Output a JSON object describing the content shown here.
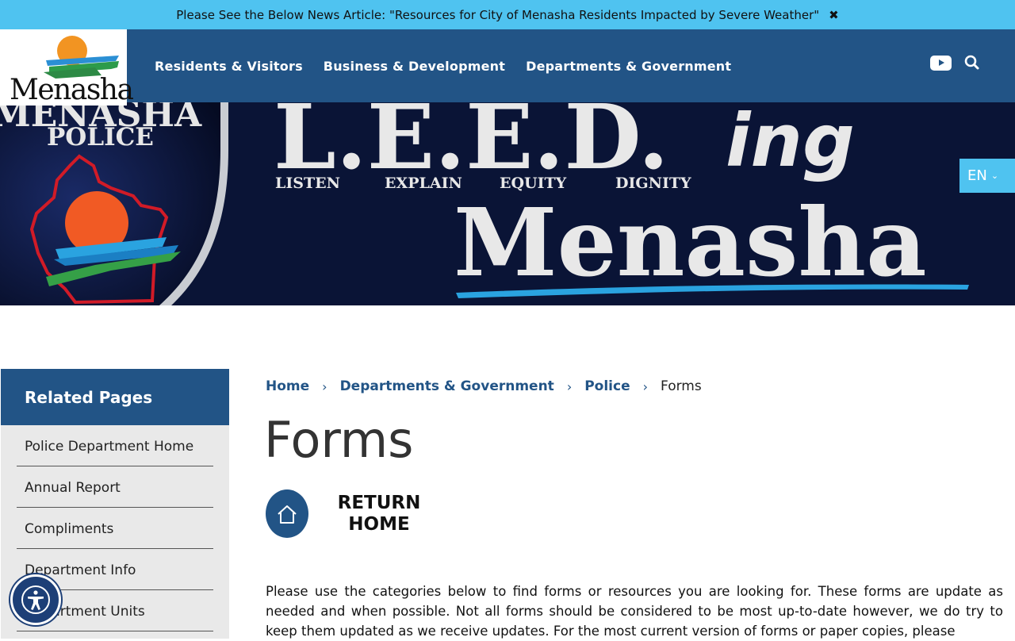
{
  "alert": {
    "text": "Please See the Below News Article: \"Resources for City of Menasha Residents Impacted by Severe Weather\"",
    "close_icon": "close-icon"
  },
  "logo": {
    "wordmark": "Menasha"
  },
  "nav": {
    "items": [
      "Residents & Visitors",
      "Business & Development",
      "Departments & Government"
    ]
  },
  "header_icons": {
    "youtube": "youtube-icon",
    "search": "search-icon"
  },
  "hero": {
    "badge_text": "MENASHA",
    "badge_sub": "POLICE",
    "headline": "L.E.E.D.",
    "headline_suffix": "ing",
    "words": [
      "LISTEN",
      "EXPLAIN",
      "EQUITY",
      "DIGNITY"
    ],
    "city": "Menasha"
  },
  "language": {
    "label": "EN"
  },
  "sidebar": {
    "heading": "Related Pages",
    "items": [
      "Police Department Home",
      "Annual Report",
      "Compliments",
      "Department Info",
      "Department Units"
    ]
  },
  "breadcrumb": {
    "home": "Home",
    "dept": "Departments & Government",
    "police": "Police",
    "current": "Forms"
  },
  "page": {
    "title": "Forms",
    "return_home": "RETURN HOME",
    "intro": "Please use the categories below to find forms or resources you are looking for.  These forms are update as needed and when possible.  Not all forms should be considered to be most up-to-date however, we do try to keep them updated as we receive updates.  For the most current version of forms or paper copies, please"
  },
  "colors": {
    "brand_blue": "#225486",
    "accent_cyan": "#4fc3f0",
    "hero_navy": "#0a1436"
  }
}
